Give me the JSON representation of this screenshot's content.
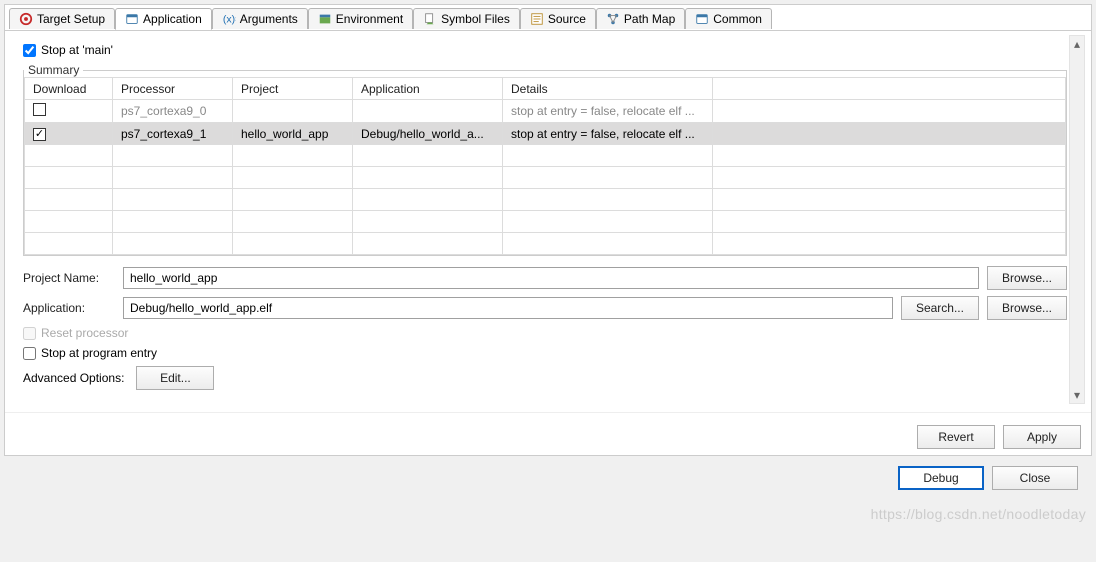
{
  "tabs": {
    "target_setup": "Target Setup",
    "application": "Application",
    "arguments": "Arguments",
    "environment": "Environment",
    "symbol_files": "Symbol Files",
    "source": "Source",
    "path_map": "Path Map",
    "common": "Common"
  },
  "stop_at_main": {
    "checked": true,
    "label": "Stop at 'main'"
  },
  "summary": {
    "legend": "Summary",
    "headers": {
      "download": "Download",
      "processor": "Processor",
      "project": "Project",
      "application": "Application",
      "details": "Details"
    },
    "rows": [
      {
        "download": false,
        "processor": "ps7_cortexa9_0",
        "project": "",
        "application": "",
        "details": "stop at entry = false, relocate elf ...",
        "dimmed": true
      },
      {
        "download": true,
        "processor": "ps7_cortexa9_1",
        "project": "hello_world_app",
        "application": "Debug/hello_world_a...",
        "details": "stop at entry = false, relocate elf ...",
        "selected": true
      }
    ]
  },
  "project_name": {
    "label": "Project Name:",
    "value": "hello_world_app",
    "browse": "Browse..."
  },
  "application": {
    "label": "Application:",
    "value": "Debug/hello_world_app.elf",
    "search": "Search...",
    "browse": "Browse..."
  },
  "reset_processor": {
    "checked": false,
    "label": "Reset processor",
    "disabled": true
  },
  "stop_program_entry": {
    "checked": false,
    "label": "Stop at program entry"
  },
  "advanced": {
    "label": "Advanced Options:",
    "edit": "Edit..."
  },
  "buttons": {
    "revert": "Revert",
    "apply": "Apply",
    "debug": "Debug",
    "close": "Close"
  },
  "watermark": "https://blog.csdn.net/noodletoday"
}
